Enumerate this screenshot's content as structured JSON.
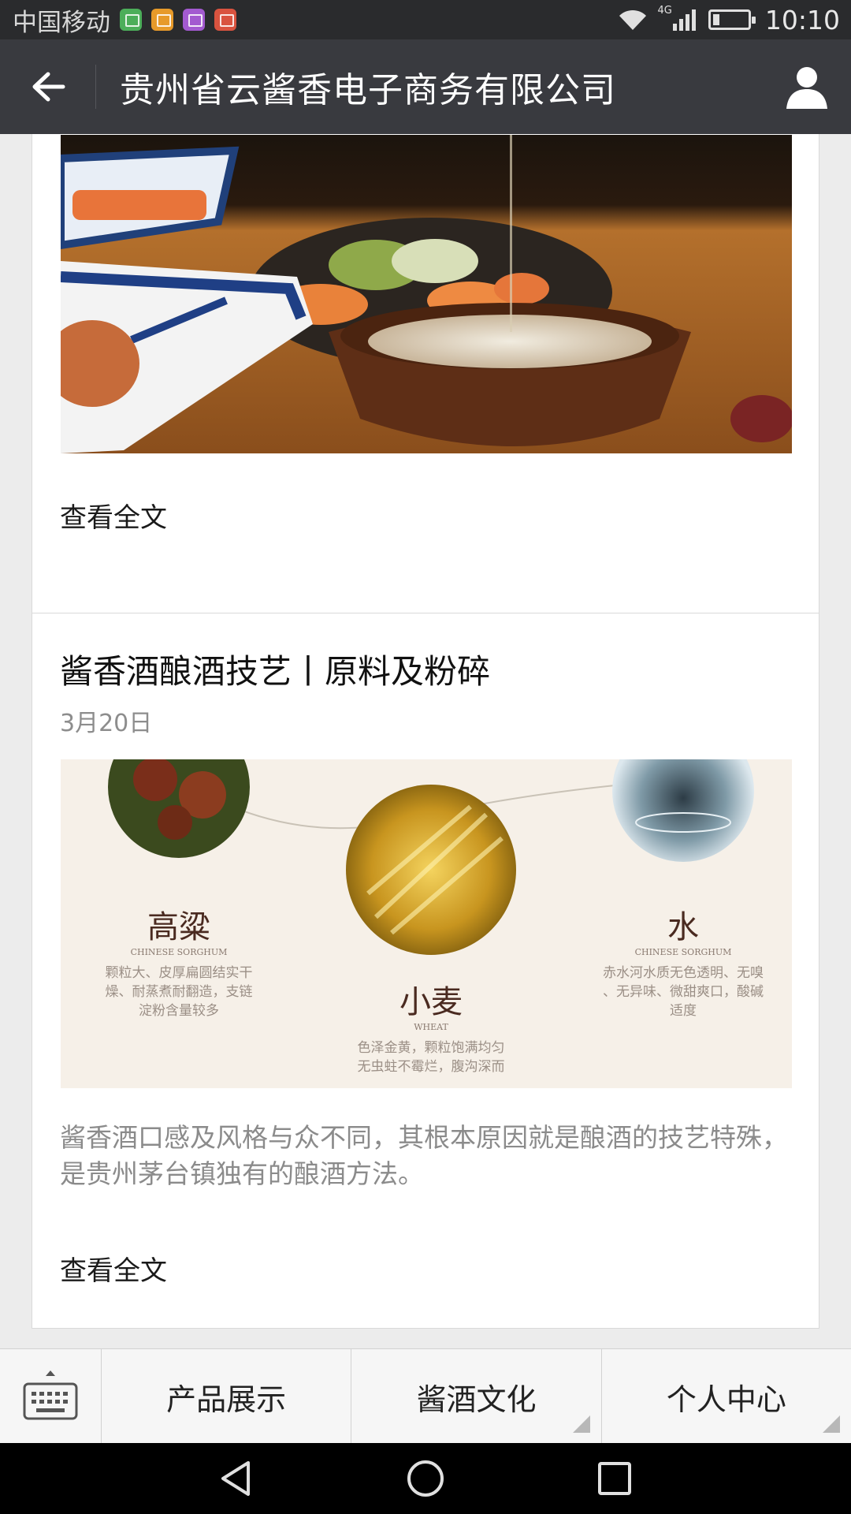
{
  "status_bar": {
    "carrier": "中国移动",
    "network": "4G",
    "time": "10:10"
  },
  "header": {
    "title": "贵州省云酱香电子商务有限公司"
  },
  "articles": [
    {
      "read_more": "查看全文"
    },
    {
      "title": "酱香酒酿酒技艺丨原料及粉碎",
      "date": "3月20日",
      "image": {
        "sorghum_title": "高粱",
        "sorghum_en": "CHINESE SORGHUM",
        "sorghum_desc_1": "颗粒大、皮厚扁圆结实干",
        "sorghum_desc_2": "燥、耐蒸煮耐翻造，支链",
        "sorghum_desc_3": "淀粉含量较多",
        "wheat_title": "小麦",
        "wheat_en": "WHEAT",
        "wheat_desc_1": "色泽金黄，颗粒饱满均匀",
        "wheat_desc_2": "无虫蛀不霉烂，腹沟深而",
        "water_title": "水",
        "water_en": "CHINESE SORGHUM",
        "water_desc_1": "赤水河水质无色透明、无嗅",
        "water_desc_2": "、无异味、微甜爽口，酸碱",
        "water_desc_3": "适度"
      },
      "excerpt": "酱香酒口感及风格与众不同，其根本原因就是酿酒的技艺特殊，是贵州茅台镇独有的酿酒方法。",
      "read_more": "查看全文"
    }
  ],
  "bottom_menu": {
    "items": [
      "产品展示",
      "酱酒文化",
      "个人中心"
    ]
  },
  "colors": {
    "status_bar_bg": "#2a2b2d",
    "header_bg": "#393a3f",
    "page_bg": "#ececec",
    "menu_bg": "#f6f6f6"
  }
}
